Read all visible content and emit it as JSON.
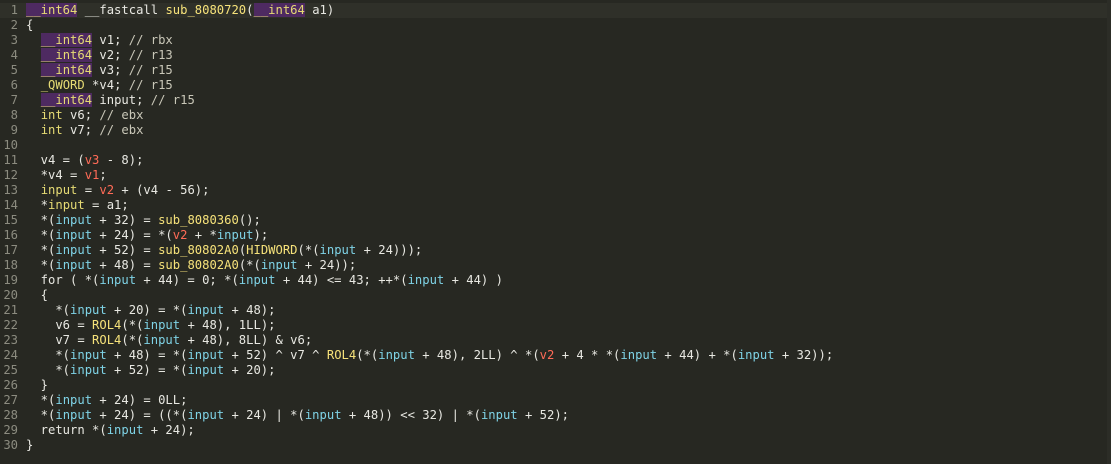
{
  "editor": {
    "lines": [
      {
        "n": "1",
        "tokens": [
          [
            "__int64",
            "typebg"
          ],
          [
            " __fastcall ",
            "plain"
          ],
          [
            "sub_8080720",
            "func"
          ],
          [
            "(",
            "plain"
          ],
          [
            "__int64",
            "typebg"
          ],
          [
            " ",
            "plain"
          ],
          [
            "a1",
            "plain"
          ],
          [
            ")",
            "plain"
          ]
        ],
        "current": true
      },
      {
        "n": "2",
        "tokens": [
          [
            "{",
            "plain"
          ]
        ]
      },
      {
        "n": "3",
        "tokens": [
          [
            "  ",
            "plain"
          ],
          [
            "__int64",
            "typebg"
          ],
          [
            " v1; ",
            "plain"
          ],
          [
            "// rbx",
            "comment"
          ]
        ]
      },
      {
        "n": "4",
        "tokens": [
          [
            "  ",
            "plain"
          ],
          [
            "__int64",
            "typebg"
          ],
          [
            " v2; ",
            "plain"
          ],
          [
            "// r13",
            "comment"
          ]
        ]
      },
      {
        "n": "5",
        "tokens": [
          [
            "  ",
            "plain"
          ],
          [
            "__int64",
            "typebg"
          ],
          [
            " v3; ",
            "plain"
          ],
          [
            "// r15",
            "comment"
          ]
        ]
      },
      {
        "n": "6",
        "tokens": [
          [
            "  ",
            "plain"
          ],
          [
            "_QWORD",
            "type"
          ],
          [
            " *v4; ",
            "plain"
          ],
          [
            "// r15",
            "comment"
          ]
        ]
      },
      {
        "n": "7",
        "tokens": [
          [
            "  ",
            "plain"
          ],
          [
            "__int64",
            "typebg"
          ],
          [
            " input; ",
            "plain"
          ],
          [
            "// r15",
            "comment"
          ]
        ]
      },
      {
        "n": "8",
        "tokens": [
          [
            "  ",
            "plain"
          ],
          [
            "int",
            "type"
          ],
          [
            " v6; ",
            "plain"
          ],
          [
            "// ebx",
            "comment"
          ]
        ]
      },
      {
        "n": "9",
        "tokens": [
          [
            "  ",
            "plain"
          ],
          [
            "int",
            "type"
          ],
          [
            " v7; ",
            "plain"
          ],
          [
            "// ebx",
            "comment"
          ]
        ]
      },
      {
        "n": "10",
        "tokens": []
      },
      {
        "n": "11",
        "tokens": [
          [
            "  v4 = (",
            "plain"
          ],
          [
            "v3",
            "arg"
          ],
          [
            " - 8);",
            "plain"
          ]
        ]
      },
      {
        "n": "12",
        "tokens": [
          [
            "  *v4 = ",
            "plain"
          ],
          [
            "v1",
            "arg"
          ],
          [
            ";",
            "plain"
          ]
        ]
      },
      {
        "n": "13",
        "tokens": [
          [
            "  ",
            "plain"
          ],
          [
            "input",
            "type"
          ],
          [
            " = ",
            "plain"
          ],
          [
            "v2",
            "arg"
          ],
          [
            " + (v4 - 56);",
            "plain"
          ]
        ]
      },
      {
        "n": "14",
        "tokens": [
          [
            "  *",
            "plain"
          ],
          [
            "input",
            "type"
          ],
          [
            " = a1;",
            "plain"
          ]
        ]
      },
      {
        "n": "15",
        "tokens": [
          [
            "  *(",
            "plain"
          ],
          [
            "input",
            "input"
          ],
          [
            " + 32) = ",
            "plain"
          ],
          [
            "sub_8080360",
            "func"
          ],
          [
            "();",
            "plain"
          ]
        ]
      },
      {
        "n": "16",
        "tokens": [
          [
            "  *(",
            "plain"
          ],
          [
            "input",
            "input"
          ],
          [
            " + 24) = *(",
            "plain"
          ],
          [
            "v2",
            "arg"
          ],
          [
            " + *",
            "plain"
          ],
          [
            "input",
            "input"
          ],
          [
            ");",
            "plain"
          ]
        ]
      },
      {
        "n": "17",
        "tokens": [
          [
            "  *(",
            "plain"
          ],
          [
            "input",
            "input"
          ],
          [
            " + 52) = ",
            "plain"
          ],
          [
            "sub_80802A0",
            "func"
          ],
          [
            "(",
            "plain"
          ],
          [
            "HIDWORD",
            "func"
          ],
          [
            "(*(",
            "plain"
          ],
          [
            "input",
            "input"
          ],
          [
            " + 24)));",
            "plain"
          ]
        ]
      },
      {
        "n": "18",
        "tokens": [
          [
            "  *(",
            "plain"
          ],
          [
            "input",
            "input"
          ],
          [
            " + 48) = ",
            "plain"
          ],
          [
            "sub_80802A0",
            "func"
          ],
          [
            "(*(",
            "plain"
          ],
          [
            "input",
            "input"
          ],
          [
            " + 24));",
            "plain"
          ]
        ]
      },
      {
        "n": "19",
        "tokens": [
          [
            "  for ( *(",
            "plain"
          ],
          [
            "input",
            "input"
          ],
          [
            " + 44) = 0; *(",
            "plain"
          ],
          [
            "input",
            "input"
          ],
          [
            " + 44) <= 43; ++*(",
            "plain"
          ],
          [
            "input",
            "input"
          ],
          [
            " + 44) )",
            "plain"
          ]
        ]
      },
      {
        "n": "20",
        "tokens": [
          [
            "  {",
            "plain"
          ]
        ]
      },
      {
        "n": "21",
        "tokens": [
          [
            "    *(",
            "plain"
          ],
          [
            "input",
            "input"
          ],
          [
            " + 20) = *(",
            "plain"
          ],
          [
            "input",
            "input"
          ],
          [
            " + 48);",
            "plain"
          ]
        ]
      },
      {
        "n": "22",
        "tokens": [
          [
            "    v6 = ",
            "plain"
          ],
          [
            "ROL4",
            "func"
          ],
          [
            "(*(",
            "plain"
          ],
          [
            "input",
            "input"
          ],
          [
            " + 48), 1LL);",
            "plain"
          ]
        ]
      },
      {
        "n": "23",
        "tokens": [
          [
            "    v7 = ",
            "plain"
          ],
          [
            "ROL4",
            "func"
          ],
          [
            "(*(",
            "plain"
          ],
          [
            "input",
            "input"
          ],
          [
            " + 48), 8LL) & v6;",
            "plain"
          ]
        ]
      },
      {
        "n": "24",
        "tokens": [
          [
            "    *(",
            "plain"
          ],
          [
            "input",
            "input"
          ],
          [
            " + 48) = *(",
            "plain"
          ],
          [
            "input",
            "input"
          ],
          [
            " + 52) ^ v7 ^ ",
            "plain"
          ],
          [
            "ROL4",
            "func"
          ],
          [
            "(*(",
            "plain"
          ],
          [
            "input",
            "input"
          ],
          [
            " + 48), 2LL) ^ *(",
            "plain"
          ],
          [
            "v2",
            "arg"
          ],
          [
            " + 4 * *(",
            "plain"
          ],
          [
            "input",
            "input"
          ],
          [
            " + 44) + *(",
            "plain"
          ],
          [
            "input",
            "input"
          ],
          [
            " + 32));",
            "plain"
          ]
        ]
      },
      {
        "n": "25",
        "tokens": [
          [
            "    *(",
            "plain"
          ],
          [
            "input",
            "input"
          ],
          [
            " + 52) = *(",
            "plain"
          ],
          [
            "input",
            "input"
          ],
          [
            " + 20);",
            "plain"
          ]
        ]
      },
      {
        "n": "26",
        "tokens": [
          [
            "  }",
            "plain"
          ]
        ]
      },
      {
        "n": "27",
        "tokens": [
          [
            "  *(",
            "plain"
          ],
          [
            "input",
            "input"
          ],
          [
            " + 24) = 0LL;",
            "plain"
          ]
        ]
      },
      {
        "n": "28",
        "tokens": [
          [
            "  *(",
            "plain"
          ],
          [
            "input",
            "input"
          ],
          [
            " + 24) = ((*(",
            "plain"
          ],
          [
            "input",
            "input"
          ],
          [
            " + 24) | *(",
            "plain"
          ],
          [
            "input",
            "input"
          ],
          [
            " + 48)) << 32) | *(",
            "plain"
          ],
          [
            "input",
            "input"
          ],
          [
            " + 52);",
            "plain"
          ]
        ]
      },
      {
        "n": "29",
        "tokens": [
          [
            "  return *(",
            "plain"
          ],
          [
            "input",
            "input"
          ],
          [
            " + 24);",
            "plain"
          ]
        ]
      },
      {
        "n": "30",
        "tokens": [
          [
            "}",
            "plain"
          ]
        ]
      }
    ]
  },
  "colors": {
    "background": "#272822",
    "type_highlight_bg": "#4e2a61",
    "type": "#e6db74",
    "argument": "#ff6b57",
    "input_var": "#7fd3e6",
    "function": "#f6e27a",
    "comment": "#c9c7b8",
    "line_number": "#8c8c80"
  }
}
